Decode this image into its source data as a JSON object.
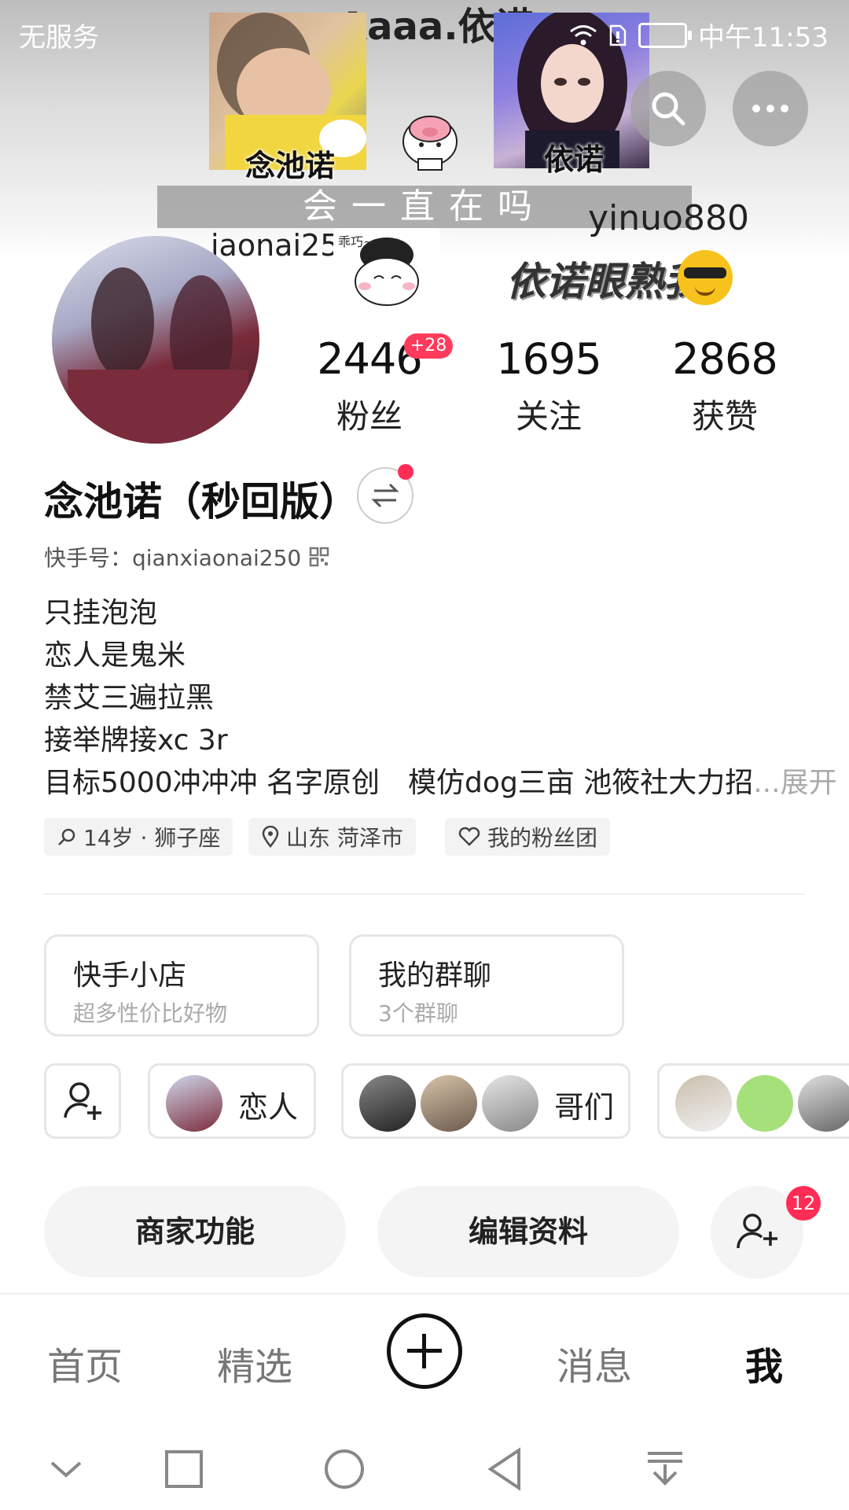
{
  "status_bar": {
    "carrier": "无服务",
    "time": "中午11:53",
    "wifi_icon": "wifi-icon",
    "sim_icon": "sim-card-icon",
    "battery_icon": "battery-icon"
  },
  "banner": {
    "title_text": "Aaaa.依诺",
    "left_caption": "念池诺",
    "right_caption": "依诺",
    "strip_text": "会一直在吗",
    "handle_text": "yinuo880",
    "partial_handle_text": "iaonai250",
    "sticker_text": "乖巧~",
    "slogan_text": "依诺眼熟我"
  },
  "header_actions": {
    "search_icon": "search-icon",
    "more_icon": "more-dots-icon"
  },
  "stats": {
    "fans": {
      "value": "2446",
      "label": "粉丝",
      "delta": "+28"
    },
    "following": {
      "value": "1695",
      "label": "关注"
    },
    "likes": {
      "value": "2868",
      "label": "获赞"
    }
  },
  "profile": {
    "name": "念池诺（秒回版）",
    "kuaishou_id": "快手号：qianxiaonai250",
    "bio": [
      "只挂泡泡",
      "恋人是鬼米",
      "禁艾三遍拉黑",
      "接举牌接xc 3r",
      "目标5000冲冲冲 名字原创　模仿dog三亩 池筱社大力招"
    ],
    "bio_more": "...展开",
    "tags": [
      {
        "icon": "gender-icon",
        "label": "14岁 · 狮子座"
      },
      {
        "icon": "location-pin-icon",
        "label": "山东 菏泽市"
      },
      {
        "icon": "heart-icon",
        "label": "我的粉丝团"
      }
    ]
  },
  "cards": [
    {
      "title": "快手小店",
      "subtitle": "超多性价比好物"
    },
    {
      "title": "我的群聊",
      "subtitle": "3个群聊"
    }
  ],
  "relations": [
    {
      "label": "恋人"
    },
    {
      "label": "哥们"
    }
  ],
  "actions": {
    "merchant": "商家功能",
    "edit_profile": "编辑资料",
    "add_friend_badge": "12"
  },
  "tabbar": {
    "home": "首页",
    "featured": "精选",
    "messages": "消息",
    "me": "我"
  },
  "colors": {
    "accent_red": "#ff2d55",
    "text_primary": "#222222",
    "text_secondary": "#aaaaaa"
  }
}
